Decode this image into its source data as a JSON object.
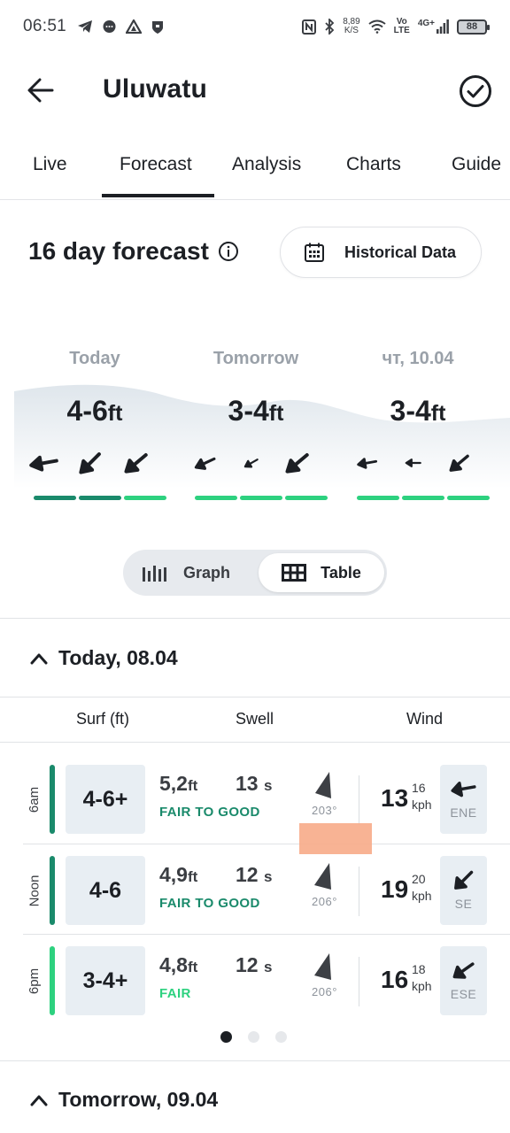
{
  "status_bar": {
    "time": "06:51",
    "net_speed_value": "8,89",
    "net_speed_unit": "K/S",
    "volte_top": "Vo",
    "volte_bottom": "LTE",
    "signal_label": "4G+",
    "battery": "88"
  },
  "header": {
    "title": "Uluwatu"
  },
  "tabs": [
    {
      "label": "Live"
    },
    {
      "label": "Forecast"
    },
    {
      "label": "Analysis"
    },
    {
      "label": "Charts"
    },
    {
      "label": "Guide"
    }
  ],
  "active_tab": "Forecast",
  "forecast": {
    "title": "16 day forecast",
    "historical_button": "Historical Data"
  },
  "days": [
    {
      "label": "Today",
      "height": "4-6",
      "unit": "ft",
      "arrow_angles": [
        -10,
        -45,
        -40
      ],
      "arrow_sizes": [
        1.0,
        1.0,
        1.0
      ],
      "bar_colors": [
        "#1a8a6b",
        "#1a8a6b",
        "#2dd17f"
      ]
    },
    {
      "label": "Tomorrow",
      "height": "3-4",
      "unit": "ft",
      "arrow_angles": [
        -25,
        -30,
        -40
      ],
      "arrow_sizes": [
        0.78,
        0.55,
        1.0
      ],
      "bar_colors": [
        "#2dd17f",
        "#2dd17f",
        "#2dd17f"
      ]
    },
    {
      "label": "чт, 10.04",
      "height": "3-4",
      "unit": "ft",
      "arrow_angles": [
        -10,
        0,
        -40
      ],
      "arrow_sizes": [
        0.7,
        0.55,
        0.85
      ],
      "bar_colors": [
        "#2dd17f",
        "#2dd17f",
        "#2dd17f"
      ]
    }
  ],
  "view_toggle": {
    "graph": "Graph",
    "table": "Table",
    "selected": "Table"
  },
  "today_section": {
    "title": "Today, 08.04"
  },
  "columns": {
    "surf": "Surf (ft)",
    "swell": "Swell",
    "wind": "Wind"
  },
  "rows": [
    {
      "time": "6am",
      "rating_color": "#1a8a6b",
      "surf": "4-6+",
      "swell_height": "5,2",
      "swell_height_unit": "ft",
      "swell_period": "13",
      "swell_period_unit": "s",
      "rating": "FAIR TO GOOD",
      "rating_text_color": "#1a8a6b",
      "swell_angle": 203,
      "swell_deg": "203°",
      "wind_speed": "13",
      "wind_gust": "16",
      "wind_unit": "kph",
      "wind_angle": -10,
      "wind_dir": "ENE"
    },
    {
      "time": "Noon",
      "rating_color": "#1a8a6b",
      "surf": "4-6",
      "swell_height": "4,9",
      "swell_height_unit": "ft",
      "swell_period": "12",
      "swell_period_unit": "s",
      "rating": "FAIR TO GOOD",
      "rating_text_color": "#1a8a6b",
      "swell_angle": 206,
      "swell_deg": "206°",
      "wind_speed": "19",
      "wind_gust": "20",
      "wind_unit": "kph",
      "wind_angle": -45,
      "wind_dir": "SE"
    },
    {
      "time": "6pm",
      "rating_color": "#2dd17f",
      "surf": "3-4+",
      "swell_height": "4,8",
      "swell_height_unit": "ft",
      "swell_period": "12",
      "swell_period_unit": "s",
      "rating": "FAIR",
      "rating_text_color": "#2dd17f",
      "swell_angle": 206,
      "swell_deg": "206°",
      "wind_speed": "16",
      "wind_gust": "18",
      "wind_unit": "kph",
      "wind_angle": -35,
      "wind_dir": "ESE"
    }
  ],
  "pager": {
    "count": 3,
    "active": 0
  },
  "tomorrow_section": {
    "title": "Tomorrow, 09.04"
  },
  "colors": {
    "good": "#1a8a6b",
    "fair": "#2dd17f",
    "highlight_overlay": "#f7ad8b"
  }
}
